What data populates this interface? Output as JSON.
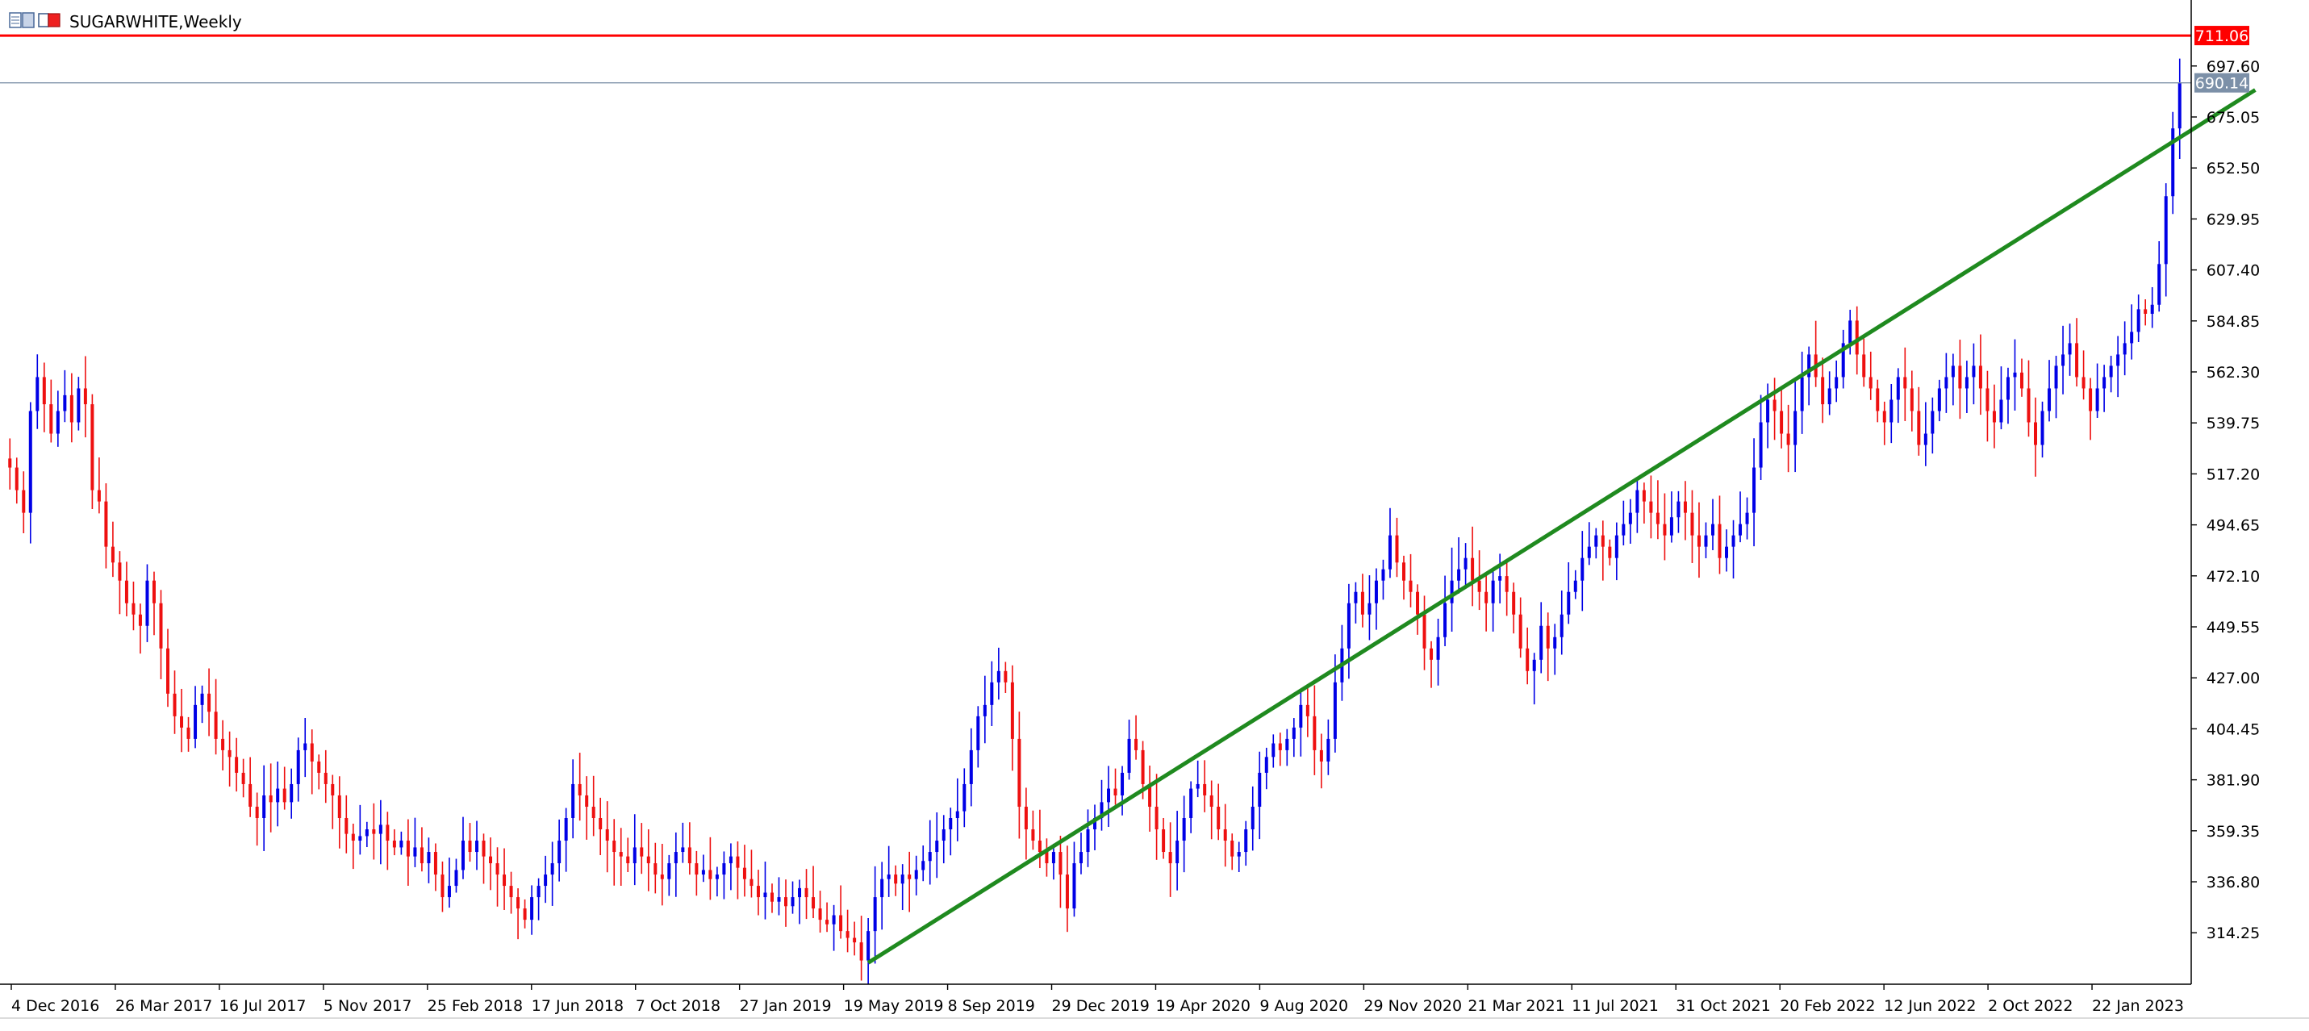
{
  "header": {
    "symbol_title": "SUGARWHITE,Weekly"
  },
  "colors": {
    "bull": "#0000e6",
    "bear": "#ee1010",
    "trendline": "#1f8a1f",
    "resistance": "#ff0000",
    "current_price_line": "#7c90a8",
    "axis": "#000000",
    "background": "#ffffff"
  },
  "chart_data": {
    "type": "candlestick",
    "title": "SUGARWHITE,Weekly",
    "y_range": [
      291.5,
      722.5
    ],
    "grid": false,
    "y_ticks": [
      "697.60",
      "675.05",
      "652.50",
      "629.95",
      "607.40",
      "584.85",
      "562.30",
      "539.75",
      "517.20",
      "494.65",
      "472.10",
      "449.55",
      "427.00",
      "404.45",
      "381.90",
      "359.35",
      "336.80",
      "314.25"
    ],
    "x_ticks": [
      "4 Dec 2016",
      "26 Mar 2017",
      "16 Jul 2017",
      "5 Nov 2017",
      "25 Feb 2018",
      "17 Jun 2018",
      "7 Oct 2018",
      "27 Jan 2019",
      "19 May 2019",
      "8 Sep 2019",
      "29 Dec 2019",
      "19 Apr 2020",
      "9 Aug 2020",
      "29 Nov 2020",
      "21 Mar 2021",
      "11 Jul 2021",
      "31 Oct 2021",
      "20 Feb 2022",
      "12 Jun 2022",
      "2 Oct 2022",
      "22 Jan 2023"
    ],
    "series": {
      "x_start": "4 Dec 2016",
      "interval": "1 week",
      "close": [
        520,
        510,
        500,
        545,
        560,
        548,
        535,
        545,
        552,
        540,
        555,
        548,
        510,
        505,
        485,
        478,
        470,
        460,
        455,
        450,
        470,
        460,
        440,
        420,
        410,
        405,
        400,
        415,
        420,
        412,
        400,
        395,
        392,
        385,
        380,
        370,
        365,
        375,
        372,
        378,
        372,
        380,
        395,
        398,
        390,
        385,
        380,
        375,
        365,
        358,
        355,
        357,
        360,
        358,
        362,
        355,
        352,
        355,
        348,
        352,
        345,
        350,
        340,
        330,
        335,
        342,
        355,
        350,
        355,
        348,
        345,
        340,
        335,
        330,
        325,
        320,
        330,
        335,
        340,
        345,
        355,
        365,
        380,
        375,
        370,
        365,
        360,
        355,
        350,
        348,
        345,
        352,
        348,
        345,
        340,
        338,
        345,
        350,
        352,
        345,
        340,
        342,
        338,
        340,
        345,
        348,
        343,
        338,
        335,
        330,
        332,
        328,
        330,
        326,
        330,
        334,
        330,
        325,
        320,
        318,
        322,
        315,
        312,
        310,
        302,
        315,
        330,
        338,
        340,
        336,
        340,
        338,
        342,
        346,
        350,
        355,
        360,
        365,
        368,
        380,
        395,
        410,
        415,
        425,
        430,
        425,
        400,
        370,
        360,
        355,
        350,
        345,
        350,
        340,
        325,
        345,
        350,
        360,
        365,
        372,
        378,
        375,
        385,
        400,
        395,
        380,
        370,
        360,
        350,
        345,
        355,
        365,
        378,
        380,
        375,
        370,
        360,
        355,
        348,
        350,
        360,
        370,
        385,
        392,
        398,
        395,
        400,
        405,
        415,
        410,
        395,
        390,
        400,
        425,
        440,
        460,
        465,
        455,
        460,
        470,
        475,
        490,
        478,
        470,
        465,
        455,
        440,
        435,
        445,
        460,
        470,
        475,
        480,
        470,
        465,
        460,
        470,
        472,
        465,
        455,
        440,
        430,
        435,
        450,
        440,
        445,
        455,
        465,
        470,
        480,
        485,
        490,
        485,
        480,
        490,
        495,
        500,
        510,
        505,
        500,
        495,
        490,
        498,
        505,
        500,
        490,
        485,
        490,
        495,
        480,
        485,
        490,
        495,
        500,
        520,
        540,
        550,
        545,
        535,
        530,
        545,
        560,
        570,
        560,
        548,
        555,
        560,
        575,
        585,
        570,
        560,
        555,
        545,
        540,
        550,
        560,
        555,
        545,
        530,
        535,
        545,
        555,
        560,
        565,
        555,
        560,
        565,
        555,
        545,
        540,
        550,
        560,
        562,
        555,
        540,
        530,
        545,
        555,
        565,
        570,
        575,
        560,
        555,
        545,
        555,
        560,
        565,
        570,
        575,
        580,
        590,
        588,
        592,
        610,
        640,
        670,
        690
      ]
    },
    "lines": {
      "resistance": 711.06,
      "current": 690.14,
      "trendline": {
        "from": {
          "week": 125,
          "price": 301
        },
        "to": {
          "week": 327,
          "price": 687
        }
      }
    },
    "price_labels": {
      "resistance": "711.06",
      "current": "690.14"
    }
  }
}
